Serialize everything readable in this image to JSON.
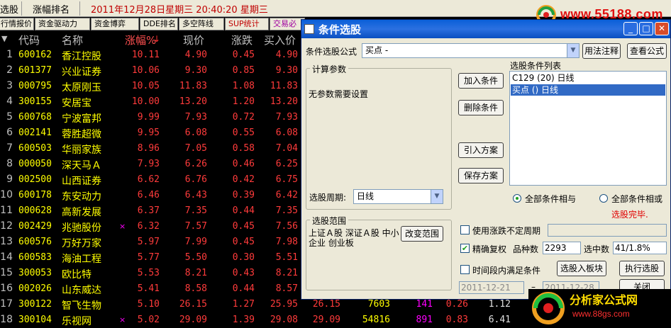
{
  "topbar": {
    "left_cut": "选股",
    "rank_label": "涨幅排名",
    "datetime": "2011年12月28日星期三  20:40:20 星期三"
  },
  "logo_top": {
    "text": "www.55188.com"
  },
  "tabs": [
    "行情报价",
    "资金驱动力",
    "资金博弈",
    "DDE排名",
    "多空阵线",
    "SUP统计",
    "交易必"
  ],
  "columns": [
    "代码",
    "名称",
    "涨幅%",
    "现价",
    "涨跌",
    "买入价"
  ],
  "rows": [
    {
      "idx": "1",
      "code": "600162",
      "name": "香江控股",
      "mark": "",
      "pct": "10.11",
      "price": "4.90",
      "chg": "0.45",
      "bid": "4.90"
    },
    {
      "idx": "2",
      "code": "601377",
      "name": "兴业证券",
      "mark": "",
      "pct": "10.06",
      "price": "9.30",
      "chg": "0.85",
      "bid": "9.30"
    },
    {
      "idx": "3",
      "code": "000795",
      "name": "太原刚玉",
      "mark": "",
      "pct": "10.05",
      "price": "11.83",
      "chg": "1.08",
      "bid": "11.83"
    },
    {
      "idx": "4",
      "code": "300155",
      "name": "安居宝",
      "mark": "",
      "pct": "10.00",
      "price": "13.20",
      "chg": "1.20",
      "bid": "13.20"
    },
    {
      "idx": "5",
      "code": "600768",
      "name": "宁波富邦",
      "mark": "",
      "pct": "9.99",
      "price": "7.93",
      "chg": "0.72",
      "bid": "7.93"
    },
    {
      "idx": "6",
      "code": "002141",
      "name": "蓉胜超微",
      "mark": "",
      "pct": "9.95",
      "price": "6.08",
      "chg": "0.55",
      "bid": "6.08"
    },
    {
      "idx": "7",
      "code": "600503",
      "name": "华丽家族",
      "mark": "",
      "pct": "8.96",
      "price": "7.05",
      "chg": "0.58",
      "bid": "7.04"
    },
    {
      "idx": "8",
      "code": "000050",
      "name": "深天马Ａ",
      "mark": "",
      "pct": "7.93",
      "price": "6.26",
      "chg": "0.46",
      "bid": "6.25"
    },
    {
      "idx": "9",
      "code": "002500",
      "name": "山西证券",
      "mark": "",
      "pct": "6.62",
      "price": "6.76",
      "chg": "0.42",
      "bid": "6.75"
    },
    {
      "idx": "10",
      "code": "600178",
      "name": "东安动力",
      "mark": "",
      "pct": "6.46",
      "price": "6.43",
      "chg": "0.39",
      "bid": "6.42"
    },
    {
      "idx": "11",
      "code": "000628",
      "name": "高新发展",
      "mark": "",
      "pct": "6.37",
      "price": "7.35",
      "chg": "0.44",
      "bid": "7.35"
    },
    {
      "idx": "12",
      "code": "002429",
      "name": "兆驰股份",
      "mark": "×",
      "pct": "6.32",
      "price": "7.57",
      "chg": "0.45",
      "bid": "7.56"
    },
    {
      "idx": "13",
      "code": "600576",
      "name": "万好万家",
      "mark": "",
      "pct": "5.97",
      "price": "7.99",
      "chg": "0.45",
      "bid": "7.98"
    },
    {
      "idx": "14",
      "code": "600583",
      "name": "海油工程",
      "mark": "",
      "pct": "5.77",
      "price": "5.50",
      "chg": "0.30",
      "bid": "5.51"
    },
    {
      "idx": "15",
      "code": "300053",
      "name": "欧比特",
      "mark": "",
      "pct": "5.53",
      "price": "8.21",
      "chg": "0.43",
      "bid": "8.21"
    },
    {
      "idx": "16",
      "code": "002026",
      "name": "山东威达",
      "mark": "",
      "pct": "5.41",
      "price": "8.58",
      "chg": "0.44",
      "bid": "8.57"
    },
    {
      "idx": "17",
      "code": "300122",
      "name": "智飞生物",
      "mark": "",
      "pct": "5.10",
      "price": "26.15",
      "chg": "1.27",
      "bid": "25.95"
    },
    {
      "idx": "18",
      "code": "300104",
      "name": "乐视网",
      "mark": "×",
      "pct": "5.02",
      "price": "29.09",
      "chg": "1.39",
      "bid": "29.08"
    }
  ],
  "row17_extra": [
    "26.15",
    "7603",
    "141",
    "0.26",
    "1.12"
  ],
  "row18_extra": [
    "29.09",
    "54816",
    "891",
    "0.83",
    "6.41"
  ],
  "dialog": {
    "title": "条件选股",
    "formula_label": "条件选股公式",
    "formula_value": "买点        -",
    "btn_usage": "用法注释",
    "btn_view_formula": "查看公式",
    "params_group": "计算参数",
    "params_text": "无参数需要设置",
    "period_label": "选股周期:",
    "period_value": "日线",
    "range_group": "选股范围",
    "range_text": "上证Ａ股 深证Ａ股 中小企业 创业板",
    "btn_change_range": "改变范围",
    "btn_add": "加入条件",
    "btn_delete": "删除条件",
    "btn_import": "引入方案",
    "btn_save": "保存方案",
    "list_title": "选股条件列表",
    "list_items": [
      "C129 (20) 日线",
      "买点  () 日线"
    ],
    "radio_all_and": "全部条件相与",
    "radio_all_or": "全部条件相或",
    "status_done": "选股完毕.",
    "cb_limit": "使用涨跌不定周期",
    "cb_exact": "精确复权",
    "stock_count_label": "品种数",
    "stock_count": "2293",
    "selected_label": "选中数",
    "selected_value": "41/1.8%",
    "cb_period": "时间段内满足条件",
    "btn_to_block": "选股入板块",
    "btn_execute": "执行选股",
    "date_from": "2011-12-21",
    "date_to": "2011-12-28",
    "btn_close": "关闭"
  },
  "logo_bottom": {
    "title": "分析家公式网",
    "url": "www.88gs.com"
  }
}
